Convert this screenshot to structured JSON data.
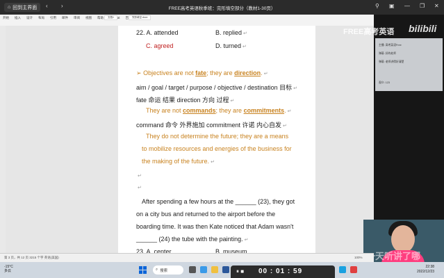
{
  "titlebar": {
    "home_label": "回到主界面",
    "back": "‹",
    "forward": "›",
    "title": "FREE高考英语秋季班：完形填空部分（教材1-30页）"
  },
  "ribbon": {
    "tabs": [
      "开始",
      "插入",
      "设计",
      "布局",
      "引用",
      "邮件",
      "审阅",
      "视图",
      "帮助",
      "Acrobat",
      "百度网盘"
    ],
    "doc_tabs": [
      "文档1",
      "完形填空.docx"
    ]
  },
  "document": {
    "q22a": "22. A. attended",
    "q22b": "B. replied",
    "q22c": "C. agreed",
    "q22d": "D. turned",
    "bullet": "➢",
    "objectives_pre": "Objectives are not ",
    "fate": "fate",
    "objectives_mid": "; they are ",
    "direction": "direction",
    "objectives_end": ".",
    "vocab1": "aim / goal / target / purpose / objective / destination  目标",
    "vocab2": "fate  命运  结果  direction  方向  过程",
    "commands_pre": "They are not ",
    "commands": "commands",
    "commands_mid": "; they are ",
    "commitments": "commitments",
    "commands_end": ".",
    "vocab3": "command  命令  外界施加  commitment  许诺  内心自发",
    "quote1": "They do not determine the future; they are a means",
    "quote2": "to mobilize resources and energies of the business for",
    "quote3": "the making of the future.",
    "return_mark": "↵",
    "passage1": "After spending a few hours at the ______ (23), they got",
    "passage2": "on a city bus and returned to the airport before the",
    "passage3": "boarding time. It was then Kate noticed that Adam wasn't",
    "passage4": "______ (24) the tube with the painting.",
    "q23a": "23. A. center",
    "q23b": "B. museum"
  },
  "stream": {
    "watermark": "FREE高考英语",
    "bili": "bilibili",
    "panel_hdr": "Free",
    "lines": [
      "主播: 高考英语Free",
      "弹幕: 好的老师",
      "弹幕: 老师讲得好清楚",
      "观众: 123"
    ]
  },
  "camera": {
    "watermark": "一天听讲了哪"
  },
  "statusbar": {
    "left": "第 3 页，共 12 页    3215 个字    英语(美国)",
    "right": "100%"
  },
  "taskbar": {
    "temp": "-15°C",
    "weather": "多云",
    "search_label": "搜索",
    "rec_icon": "⏸ ■",
    "time": "00 : 01 : 59",
    "clock_time": "22:38",
    "clock_date": "2022/12/23"
  },
  "colors": {
    "orange": "#c8821f",
    "red": "#c02020",
    "accent": "#0a64d8"
  }
}
